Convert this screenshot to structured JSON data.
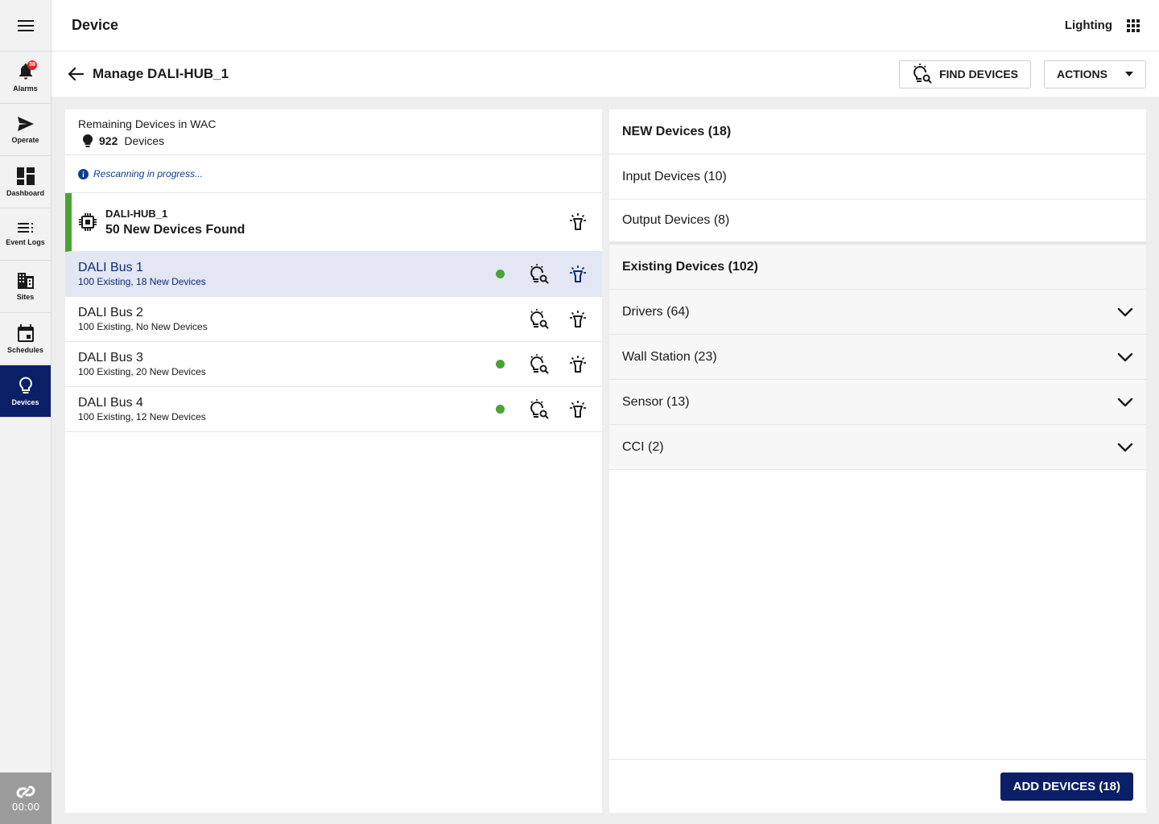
{
  "nav": {
    "items": [
      {
        "label": "Alarms",
        "icon": "bell-icon",
        "badge": "38"
      },
      {
        "label": "Operate",
        "icon": "send-icon"
      },
      {
        "label": "Dashboard",
        "icon": "dashboard-icon"
      },
      {
        "label": "Event Logs",
        "icon": "list-icon"
      },
      {
        "label": "Sites",
        "icon": "building-icon"
      },
      {
        "label": "Schedules",
        "icon": "calendar-icon"
      },
      {
        "label": "Devices",
        "icon": "lightbulb-icon",
        "active": true
      }
    ],
    "timer": "00:00"
  },
  "header": {
    "title": "Device",
    "app_name": "Lighting"
  },
  "subheader": {
    "title": "Manage DALI-HUB_1",
    "find_devices_label": "FIND DEVICES",
    "actions_label": "ACTIONS"
  },
  "left_panel": {
    "remaining_label": "Remaining Devices in WAC",
    "remaining_count": "922",
    "remaining_unit": "Devices",
    "status_text": "Rescanning in progress...",
    "hub": {
      "name": "DALI-HUB_1",
      "found_text": "50 New Devices Found"
    },
    "buses": [
      {
        "name": "DALI Bus 1",
        "subtitle": "100 Existing, 18 New Devices",
        "has_new": true,
        "selected": true
      },
      {
        "name": "DALI Bus 2",
        "subtitle": "100 Existing, No New Devices",
        "has_new": false,
        "selected": false
      },
      {
        "name": "DALI Bus 3",
        "subtitle": "100 Existing, 20 New Devices",
        "has_new": true,
        "selected": false
      },
      {
        "name": "DALI Bus 4",
        "subtitle": "100 Existing, 12 New Devices",
        "has_new": true,
        "selected": false
      }
    ]
  },
  "right_panel": {
    "new_devices_label": "NEW Devices (18)",
    "new_groups": [
      "Input Devices (10)",
      "Output Devices (8)"
    ],
    "existing_label": "Existing Devices (102)",
    "existing_groups": [
      "Drivers (64)",
      "Wall Station (23)",
      "Sensor (13)",
      "CCI (2)"
    ],
    "add_button_label": "ADD DEVICES (18)"
  },
  "colors": {
    "primary": "#0a1f66",
    "selected_row": "#e3e6f3",
    "status_green": "#4ba236",
    "badge_red": "#e02424",
    "info_blue": "#0a3f8c"
  }
}
